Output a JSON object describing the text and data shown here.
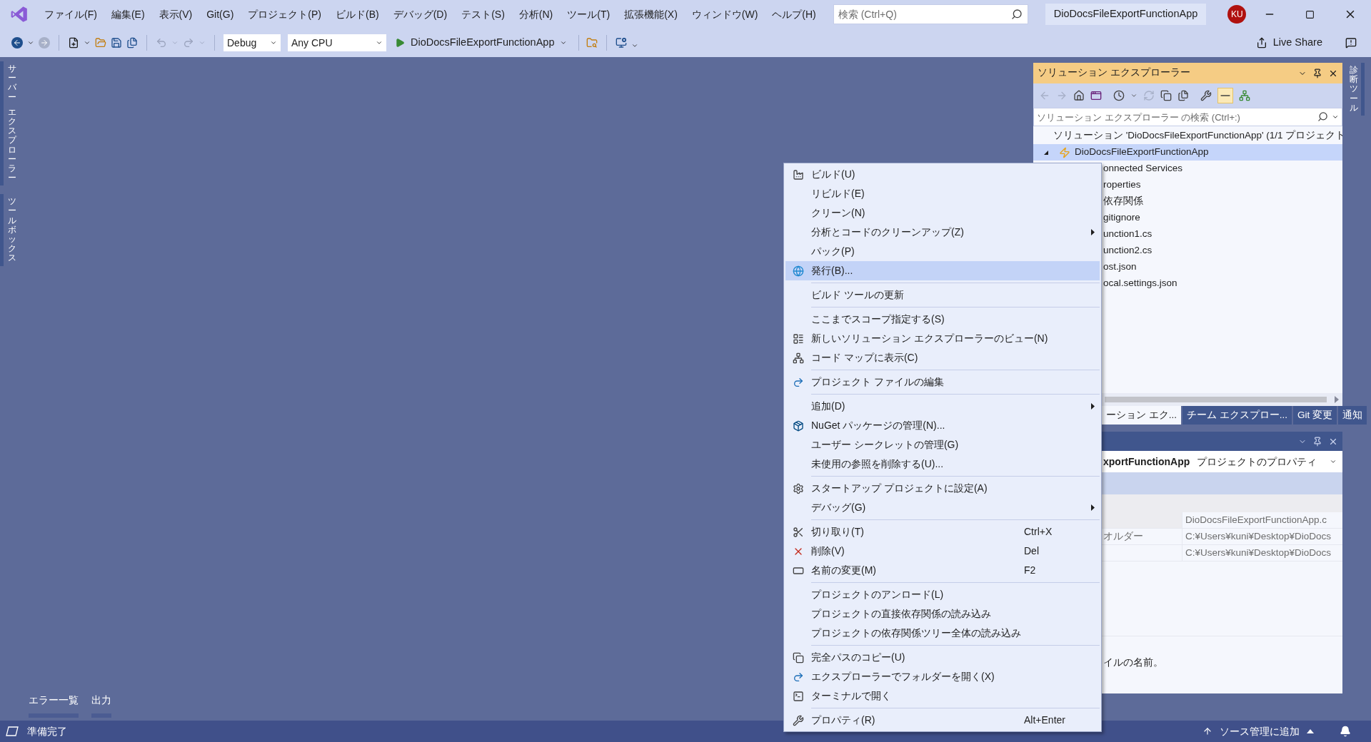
{
  "title_bar": {
    "menu": [
      "ファイル(F)",
      "編集(E)",
      "表示(V)",
      "Git(G)",
      "プロジェクト(P)",
      "ビルド(B)",
      "デバッグ(D)",
      "テスト(S)",
      "分析(N)",
      "ツール(T)",
      "拡張機能(X)",
      "ウィンドウ(W)",
      "ヘルプ(H)"
    ],
    "search": {
      "placeholder": "検索 (Ctrl+Q)"
    },
    "solution_name": "DioDocsFileExportFunctionApp",
    "avatar": "KU"
  },
  "toolbar": {
    "configuration": "Debug",
    "platform": "Any CPU",
    "startup_project": "DioDocsFileExportFunctionApp",
    "live_share": "Live Share"
  },
  "left_tabs": [
    {
      "words": [
        "サーバー",
        "エクスプローラー"
      ]
    },
    {
      "words": [
        "ツールボックス"
      ]
    }
  ],
  "right_tabs": [
    {
      "words": [
        "診断ツール"
      ]
    }
  ],
  "bottom_tabs": [
    "エラー一覧",
    "出力"
  ],
  "solution_explorer": {
    "title": "ソリューション エクスプローラー",
    "search": {
      "placeholder": "ソリューション エクスプローラー の検索 (Ctrl+:)"
    },
    "tree": [
      {
        "label": "ソリューション 'DioDocsFileExportFunctionApp' (1/1 プロジェクト",
        "selected": false,
        "children": [
          {
            "label": "DioDocsFileExportFunctionApp",
            "selected": true,
            "expanded": true,
            "children": [
              {
                "label": "onnected Services",
                "selected": false
              },
              {
                "label": "roperties",
                "selected": false
              },
              {
                "label": "依存関係",
                "selected": false
              },
              {
                "label": "gitignore",
                "selected": false
              },
              {
                "label": "unction1.cs",
                "selected": false
              },
              {
                "label": "unction2.cs",
                "selected": false
              },
              {
                "label": "ost.json",
                "selected": false
              },
              {
                "label": "ocal.settings.json",
                "selected": false
              }
            ]
          }
        ]
      }
    ],
    "tabs": [
      {
        "label": "ーション エク...",
        "selected": true
      },
      {
        "label": "チーム エクスプロー...",
        "selected": false
      },
      {
        "label": "Git 変更",
        "selected": false
      },
      {
        "label": "通知",
        "selected": false
      }
    ]
  },
  "properties": {
    "object": "xportFunctionApp",
    "object_type": "プロジェクトのプロパティ",
    "rows": [
      {
        "value": "DioDocsFileExportFunctionApp.c"
      },
      {
        "name": "オルダー",
        "value": "C:¥Users¥kuni¥Desktop¥DioDocs"
      },
      {
        "value": "C:¥Users¥kuni¥Desktop¥DioDocs"
      }
    ],
    "description": "イルの名前。"
  },
  "context_menu": {
    "groups": [
      [
        {
          "label": "ビルド(U)",
          "selected": false,
          "submenu": false
        },
        {
          "label": "リビルド(E)",
          "selected": false,
          "submenu": false
        },
        {
          "label": "クリーン(N)",
          "selected": false,
          "submenu": false
        },
        {
          "label": "分析とコードのクリーンアップ(Z)",
          "selected": false,
          "submenu": true
        },
        {
          "label": "パック(P)",
          "selected": false,
          "submenu": false
        },
        {
          "label": "発行(B)...",
          "selected": true,
          "submenu": false
        }
      ],
      [
        {
          "label": "ビルド ツールの更新",
          "selected": false,
          "submenu": false
        }
      ],
      [
        {
          "label": "ここまでスコープ指定する(S)",
          "selected": false,
          "submenu": false
        },
        {
          "label": "新しいソリューション エクスプローラーのビュー(N)",
          "selected": false,
          "submenu": false
        },
        {
          "label": "コード マップに表示(C)",
          "selected": false,
          "submenu": false
        }
      ],
      [
        {
          "label": "プロジェクト ファイルの編集",
          "selected": false,
          "submenu": false
        }
      ],
      [
        {
          "label": "追加(D)",
          "selected": false,
          "submenu": true
        },
        {
          "label": "NuGet パッケージの管理(N)...",
          "selected": false,
          "submenu": false
        },
        {
          "label": "ユーザー シークレットの管理(G)",
          "selected": false,
          "submenu": false
        },
        {
          "label": "未使用の参照を削除する(U)...",
          "selected": false,
          "submenu": false
        }
      ],
      [
        {
          "label": "スタートアップ プロジェクトに設定(A)",
          "selected": false,
          "submenu": false
        },
        {
          "label": "デバッグ(G)",
          "selected": false,
          "submenu": true
        }
      ],
      [
        {
          "label": "切り取り(T)",
          "shortcut": "Ctrl+X",
          "selected": false,
          "submenu": false
        },
        {
          "label": "削除(V)",
          "shortcut": "Del",
          "selected": false,
          "submenu": false
        },
        {
          "label": "名前の変更(M)",
          "shortcut": "F2",
          "selected": false,
          "submenu": false
        }
      ],
      [
        {
          "label": "プロジェクトのアンロード(L)",
          "selected": false,
          "submenu": false
        },
        {
          "label": "プロジェクトの直接依存関係の読み込み",
          "selected": false,
          "submenu": false
        },
        {
          "label": "プロジェクトの依存関係ツリー全体の読み込み",
          "selected": false,
          "submenu": false
        }
      ],
      [
        {
          "label": "完全パスのコピー(U)",
          "selected": false,
          "submenu": false
        },
        {
          "label": "エクスプローラーでフォルダーを開く(X)",
          "selected": false,
          "submenu": false
        },
        {
          "label": "ターミナルで開く",
          "selected": false,
          "submenu": false
        }
      ],
      [
        {
          "label": "プロパティ(R)",
          "shortcut": "Alt+Enter",
          "selected": false,
          "submenu": false
        }
      ]
    ]
  },
  "status_bar": {
    "status": "準備完了",
    "source_control": "ソース管理に追加"
  }
}
